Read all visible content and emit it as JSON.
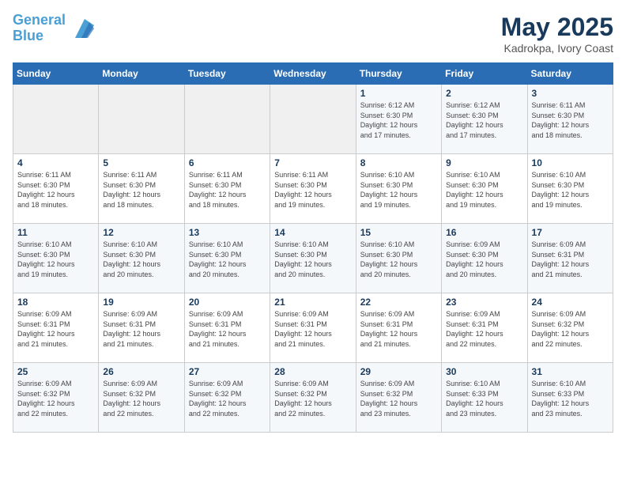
{
  "header": {
    "logo_line1": "General",
    "logo_line2": "Blue",
    "month": "May 2025",
    "location": "Kadrokpa, Ivory Coast"
  },
  "weekdays": [
    "Sunday",
    "Monday",
    "Tuesday",
    "Wednesday",
    "Thursday",
    "Friday",
    "Saturday"
  ],
  "weeks": [
    [
      {
        "day": "",
        "info": ""
      },
      {
        "day": "",
        "info": ""
      },
      {
        "day": "",
        "info": ""
      },
      {
        "day": "",
        "info": ""
      },
      {
        "day": "1",
        "info": "Sunrise: 6:12 AM\nSunset: 6:30 PM\nDaylight: 12 hours\nand 17 minutes."
      },
      {
        "day": "2",
        "info": "Sunrise: 6:12 AM\nSunset: 6:30 PM\nDaylight: 12 hours\nand 17 minutes."
      },
      {
        "day": "3",
        "info": "Sunrise: 6:11 AM\nSunset: 6:30 PM\nDaylight: 12 hours\nand 18 minutes."
      }
    ],
    [
      {
        "day": "4",
        "info": "Sunrise: 6:11 AM\nSunset: 6:30 PM\nDaylight: 12 hours\nand 18 minutes."
      },
      {
        "day": "5",
        "info": "Sunrise: 6:11 AM\nSunset: 6:30 PM\nDaylight: 12 hours\nand 18 minutes."
      },
      {
        "day": "6",
        "info": "Sunrise: 6:11 AM\nSunset: 6:30 PM\nDaylight: 12 hours\nand 18 minutes."
      },
      {
        "day": "7",
        "info": "Sunrise: 6:11 AM\nSunset: 6:30 PM\nDaylight: 12 hours\nand 19 minutes."
      },
      {
        "day": "8",
        "info": "Sunrise: 6:10 AM\nSunset: 6:30 PM\nDaylight: 12 hours\nand 19 minutes."
      },
      {
        "day": "9",
        "info": "Sunrise: 6:10 AM\nSunset: 6:30 PM\nDaylight: 12 hours\nand 19 minutes."
      },
      {
        "day": "10",
        "info": "Sunrise: 6:10 AM\nSunset: 6:30 PM\nDaylight: 12 hours\nand 19 minutes."
      }
    ],
    [
      {
        "day": "11",
        "info": "Sunrise: 6:10 AM\nSunset: 6:30 PM\nDaylight: 12 hours\nand 19 minutes."
      },
      {
        "day": "12",
        "info": "Sunrise: 6:10 AM\nSunset: 6:30 PM\nDaylight: 12 hours\nand 20 minutes."
      },
      {
        "day": "13",
        "info": "Sunrise: 6:10 AM\nSunset: 6:30 PM\nDaylight: 12 hours\nand 20 minutes."
      },
      {
        "day": "14",
        "info": "Sunrise: 6:10 AM\nSunset: 6:30 PM\nDaylight: 12 hours\nand 20 minutes."
      },
      {
        "day": "15",
        "info": "Sunrise: 6:10 AM\nSunset: 6:30 PM\nDaylight: 12 hours\nand 20 minutes."
      },
      {
        "day": "16",
        "info": "Sunrise: 6:09 AM\nSunset: 6:30 PM\nDaylight: 12 hours\nand 20 minutes."
      },
      {
        "day": "17",
        "info": "Sunrise: 6:09 AM\nSunset: 6:31 PM\nDaylight: 12 hours\nand 21 minutes."
      }
    ],
    [
      {
        "day": "18",
        "info": "Sunrise: 6:09 AM\nSunset: 6:31 PM\nDaylight: 12 hours\nand 21 minutes."
      },
      {
        "day": "19",
        "info": "Sunrise: 6:09 AM\nSunset: 6:31 PM\nDaylight: 12 hours\nand 21 minutes."
      },
      {
        "day": "20",
        "info": "Sunrise: 6:09 AM\nSunset: 6:31 PM\nDaylight: 12 hours\nand 21 minutes."
      },
      {
        "day": "21",
        "info": "Sunrise: 6:09 AM\nSunset: 6:31 PM\nDaylight: 12 hours\nand 21 minutes."
      },
      {
        "day": "22",
        "info": "Sunrise: 6:09 AM\nSunset: 6:31 PM\nDaylight: 12 hours\nand 21 minutes."
      },
      {
        "day": "23",
        "info": "Sunrise: 6:09 AM\nSunset: 6:31 PM\nDaylight: 12 hours\nand 22 minutes."
      },
      {
        "day": "24",
        "info": "Sunrise: 6:09 AM\nSunset: 6:32 PM\nDaylight: 12 hours\nand 22 minutes."
      }
    ],
    [
      {
        "day": "25",
        "info": "Sunrise: 6:09 AM\nSunset: 6:32 PM\nDaylight: 12 hours\nand 22 minutes."
      },
      {
        "day": "26",
        "info": "Sunrise: 6:09 AM\nSunset: 6:32 PM\nDaylight: 12 hours\nand 22 minutes."
      },
      {
        "day": "27",
        "info": "Sunrise: 6:09 AM\nSunset: 6:32 PM\nDaylight: 12 hours\nand 22 minutes."
      },
      {
        "day": "28",
        "info": "Sunrise: 6:09 AM\nSunset: 6:32 PM\nDaylight: 12 hours\nand 22 minutes."
      },
      {
        "day": "29",
        "info": "Sunrise: 6:09 AM\nSunset: 6:32 PM\nDaylight: 12 hours\nand 23 minutes."
      },
      {
        "day": "30",
        "info": "Sunrise: 6:10 AM\nSunset: 6:33 PM\nDaylight: 12 hours\nand 23 minutes."
      },
      {
        "day": "31",
        "info": "Sunrise: 6:10 AM\nSunset: 6:33 PM\nDaylight: 12 hours\nand 23 minutes."
      }
    ]
  ]
}
